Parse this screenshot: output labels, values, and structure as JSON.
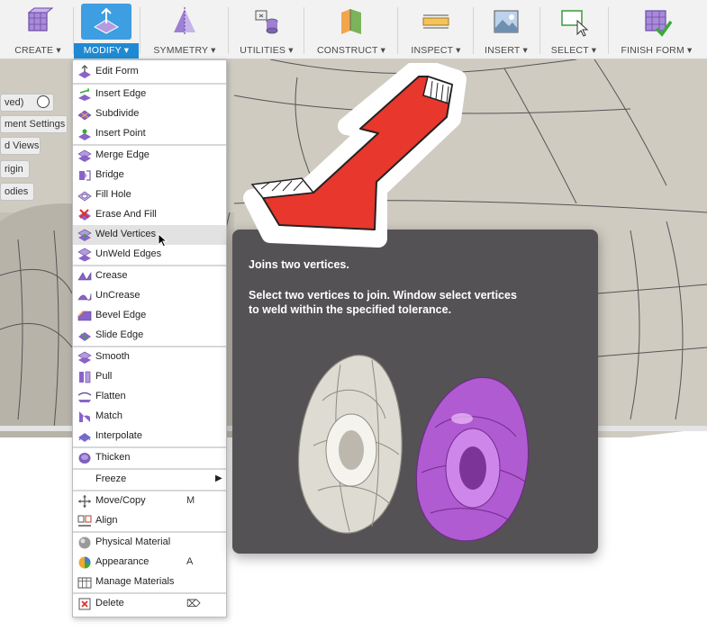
{
  "toolbar": {
    "groups": [
      {
        "label": "CREATE ▾",
        "icon": "create-form-icon"
      },
      {
        "label": "MODIFY ▾",
        "icon": "modify-icon",
        "active": true
      },
      {
        "label": "SYMMETRY ▾",
        "icon": "symmetry-icon"
      },
      {
        "label": "UTILITIES ▾",
        "icon": "utilities-icon"
      },
      {
        "label": "CONSTRUCT ▾",
        "icon": "construct-icon"
      },
      {
        "label": "INSPECT ▾",
        "icon": "inspect-icon"
      },
      {
        "label": "INSERT ▾",
        "icon": "insert-icon"
      },
      {
        "label": "SELECT ▾",
        "icon": "select-icon"
      },
      {
        "label": "FINISH FORM ▾",
        "icon": "finish-form-icon"
      }
    ]
  },
  "browser": {
    "items": [
      "ved)",
      "ment Settings",
      "d Views",
      "rigin",
      "odies"
    ]
  },
  "menu": {
    "items": [
      {
        "label": "Edit Form",
        "icon": "edit-form-icon"
      },
      {
        "label": "Insert Edge",
        "icon": "insert-edge-icon"
      },
      {
        "label": "Subdivide",
        "icon": "subdivide-icon"
      },
      {
        "label": "Insert Point",
        "icon": "insert-point-icon"
      },
      {
        "label": "Merge Edge",
        "icon": "merge-edge-icon"
      },
      {
        "label": "Bridge",
        "icon": "bridge-icon"
      },
      {
        "label": "Fill Hole",
        "icon": "fill-hole-icon"
      },
      {
        "label": "Erase And Fill",
        "icon": "erase-and-fill-icon"
      },
      {
        "label": "Weld Vertices",
        "icon": "weld-vertices-icon",
        "hover": true
      },
      {
        "label": "UnWeld Edges",
        "icon": "unweld-edges-icon"
      },
      {
        "label": "Crease",
        "icon": "crease-icon"
      },
      {
        "label": "UnCrease",
        "icon": "uncrease-icon"
      },
      {
        "label": "Bevel Edge",
        "icon": "bevel-edge-icon"
      },
      {
        "label": "Slide Edge",
        "icon": "slide-edge-icon"
      },
      {
        "label": "Smooth",
        "icon": "smooth-icon"
      },
      {
        "label": "Pull",
        "icon": "pull-icon"
      },
      {
        "label": "Flatten",
        "icon": "flatten-icon"
      },
      {
        "label": "Match",
        "icon": "match-icon"
      },
      {
        "label": "Interpolate",
        "icon": "interpolate-icon"
      },
      {
        "label": "Thicken",
        "icon": "thicken-icon"
      },
      {
        "label": "Freeze",
        "icon": "",
        "submenu": true
      },
      {
        "label": "Move/Copy",
        "icon": "move-copy-icon",
        "shortcut": "M"
      },
      {
        "label": "Align",
        "icon": "align-icon"
      },
      {
        "label": "Physical Material",
        "icon": "physical-material-icon"
      },
      {
        "label": "Appearance",
        "icon": "appearance-icon",
        "shortcut": "A"
      },
      {
        "label": "Manage Materials",
        "icon": "manage-materials-icon"
      },
      {
        "label": "Delete",
        "icon": "delete-icon",
        "shortcut": "⌦"
      }
    ]
  },
  "tooltip": {
    "title": "Joins two vertices.",
    "description": "Select two vertices to join. Window select vertices to weld within the specified tolerance."
  },
  "colors": {
    "accent": "#1f8ad3",
    "tooltip_bg": "#545254",
    "arrow_red": "#e8372c",
    "model_purple": "#b05bd1",
    "model_white": "#dedbd3",
    "icon_purple": "#8a63c9"
  }
}
